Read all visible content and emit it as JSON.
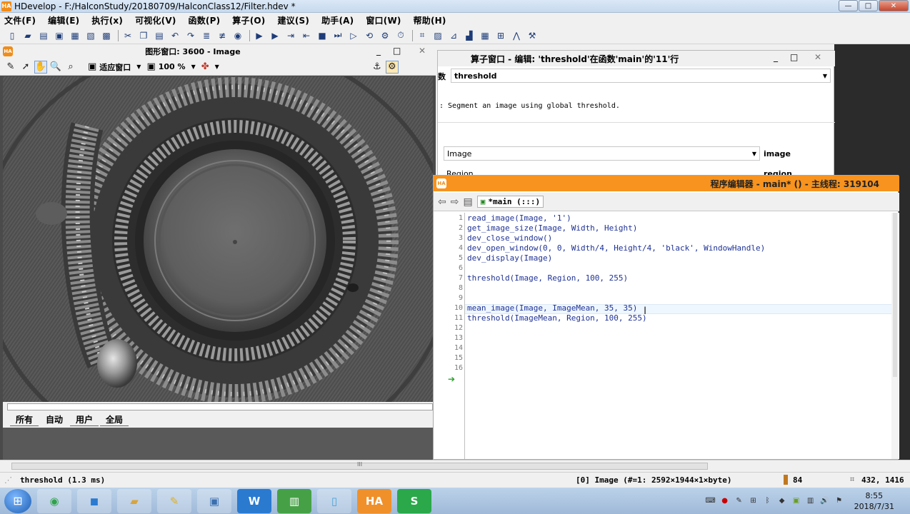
{
  "window": {
    "app_logo": "HA",
    "title": "HDevelop - F:/HalconStudy/20180709/HalconClass12/Filter.hdev *",
    "controls": [
      "—",
      "□",
      "✕"
    ]
  },
  "menu": [
    "文件(F)",
    "编辑(E)",
    "执行(x)",
    "可视化(V)",
    "函数(P)",
    "算子(O)",
    "建议(S)",
    "助手(A)",
    "窗口(W)",
    "帮助(H)"
  ],
  "toolbar": {
    "icons": [
      "new-file",
      "open-file",
      "open-folder",
      "save",
      "save-as",
      "export",
      "settings",
      "cut",
      "copy",
      "paste",
      "undo",
      "redo",
      "insert",
      "delete-line",
      "run-to",
      "run",
      "step-over",
      "step-into",
      "step-out",
      "stop",
      "step-forward",
      "exec-procedure",
      "reset",
      "record",
      "clock",
      "image-tools",
      "open-graphics",
      "histogram",
      "line-profile",
      "gray-histogram",
      "feature-inspection",
      "calibration"
    ]
  },
  "graphics": {
    "logo": "HA",
    "title": "图形窗口: 3600 - Image",
    "minimize": "_",
    "maximize": "□",
    "close": "✕",
    "tools": {
      "fit_label": "适应窗口",
      "zoom_label": "100 %"
    },
    "tabs": [
      "所有",
      "自动",
      "用户",
      "全局"
    ]
  },
  "operator": {
    "title": "算子窗口 - 编辑: 'threshold'在函数'main'的'11'行",
    "minimize": "_",
    "maximize": "□",
    "close": "✕",
    "label_fragment": "数",
    "name": "threshold",
    "description": ": Segment an image using global threshold.",
    "param1_value": "Image",
    "param1_name": "image",
    "param2_value": "Region",
    "param2_name": "region"
  },
  "editor": {
    "logo": "HA",
    "title": "程序编辑器 - main* () - 主线程: 319104",
    "procedure": "*main (:::)",
    "lines": [
      {
        "n": "1",
        "code": "read_image(Image, '1')"
      },
      {
        "n": "2",
        "code": "get_image_size(Image, Width, Height)"
      },
      {
        "n": "3",
        "code": "dev_close_window()"
      },
      {
        "n": "4",
        "code": "dev_open_window(0, 0, Width/4, Height/4, 'black', WindowHandle)"
      },
      {
        "n": "5",
        "code": "dev_display(Image)"
      },
      {
        "n": "6",
        "code": ""
      },
      {
        "n": "7",
        "code": "threshold(Image, Region, 100, 255)"
      },
      {
        "n": "8",
        "code": ""
      },
      {
        "n": "9",
        "code": ""
      },
      {
        "n": "10",
        "code": "mean_image(Image, ImageMean, 35, 35)"
      },
      {
        "n": "11",
        "code": "threshold(ImageMean, Region, 100, 255)"
      },
      {
        "n": "12",
        "code": ""
      },
      {
        "n": "13",
        "code": ""
      },
      {
        "n": "14",
        "code": ""
      },
      {
        "n": "15",
        "code": ""
      },
      {
        "n": "16",
        "code": ""
      }
    ]
  },
  "scrollbar": {
    "grip": "III"
  },
  "status": {
    "timing": "threshold (1.3 ms)",
    "image_info": "[0] Image (#=1: 2592×1944×1×byte)",
    "gray_value": "84",
    "coords": "432, 1416"
  },
  "taskbar": {
    "apps": [
      "browser",
      "video-app",
      "file-explorer",
      "paint",
      "screenshot",
      "wps-writer",
      "code-editor",
      "notepad",
      "halcon",
      "wps-sheets"
    ],
    "app_labels": {
      "halcon": "HA",
      "wps_writer": "W",
      "wps_sheets": "S"
    },
    "clock_time": "8:55",
    "clock_date": "2018/7/31"
  }
}
